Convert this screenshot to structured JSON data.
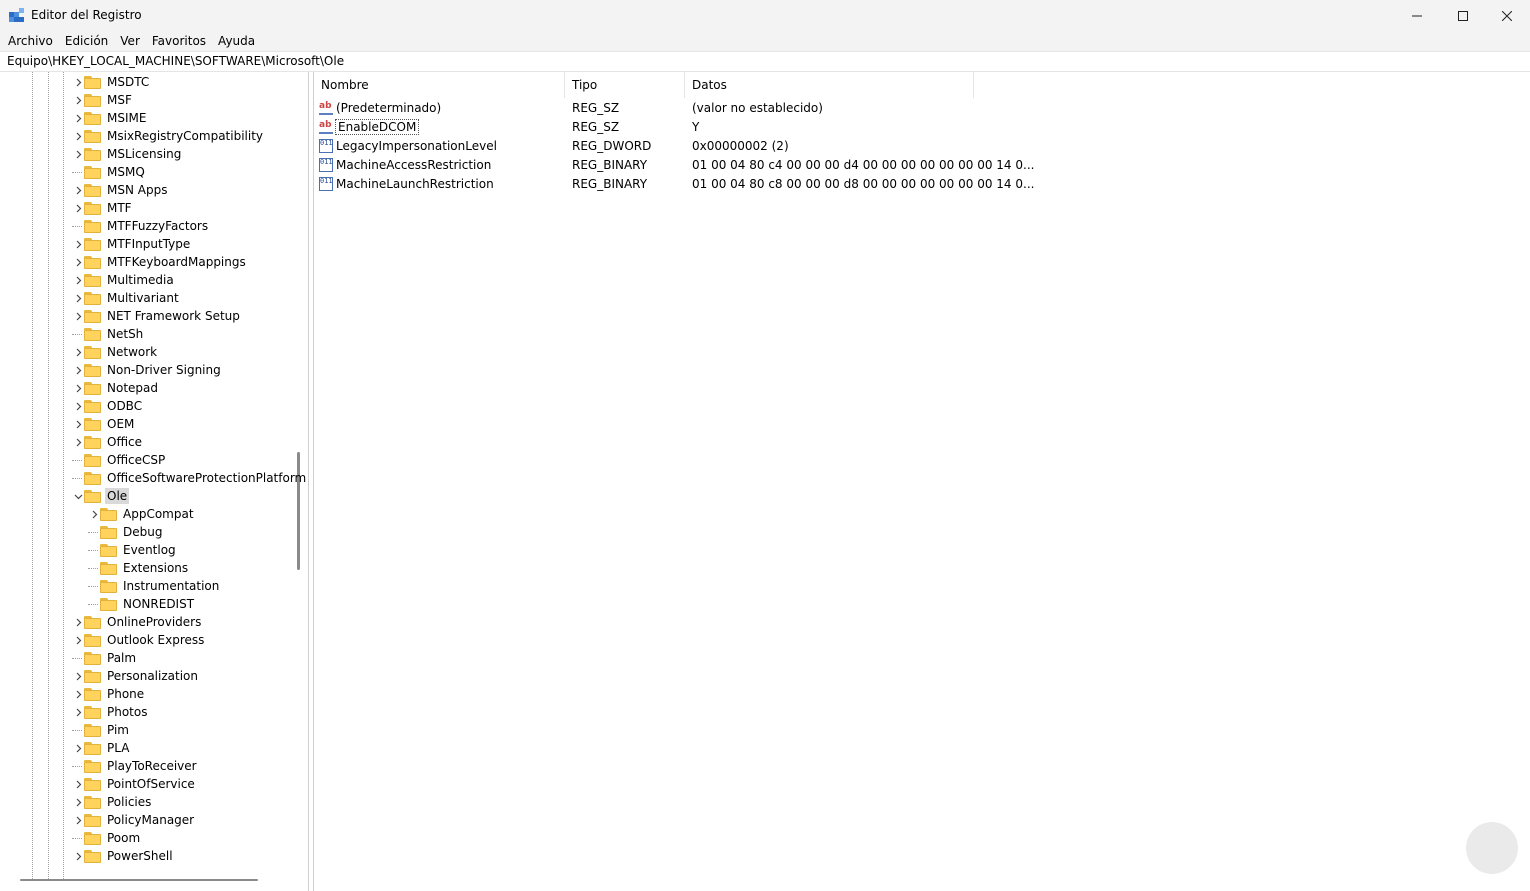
{
  "window": {
    "title": "Editor del Registro",
    "icon": "registry-editor-icon"
  },
  "menu": [
    "Archivo",
    "Edición",
    "Ver",
    "Favoritos",
    "Ayuda"
  ],
  "address": "Equipo\\HKEY_LOCAL_MACHINE\\SOFTWARE\\Microsoft\\Ole",
  "tree": [
    {
      "label": "MSDTC",
      "expandable": true
    },
    {
      "label": "MSF",
      "expandable": true
    },
    {
      "label": "MSIME",
      "expandable": true
    },
    {
      "label": "MsixRegistryCompatibility",
      "expandable": true
    },
    {
      "label": "MSLicensing",
      "expandable": true
    },
    {
      "label": "MSMQ",
      "expandable": false
    },
    {
      "label": "MSN Apps",
      "expandable": true
    },
    {
      "label": "MTF",
      "expandable": true
    },
    {
      "label": "MTFFuzzyFactors",
      "expandable": false
    },
    {
      "label": "MTFInputType",
      "expandable": true
    },
    {
      "label": "MTFKeyboardMappings",
      "expandable": true
    },
    {
      "label": "Multimedia",
      "expandable": true
    },
    {
      "label": "Multivariant",
      "expandable": true
    },
    {
      "label": "NET Framework Setup",
      "expandable": true
    },
    {
      "label": "NetSh",
      "expandable": false
    },
    {
      "label": "Network",
      "expandable": true
    },
    {
      "label": "Non-Driver Signing",
      "expandable": true
    },
    {
      "label": "Notepad",
      "expandable": true
    },
    {
      "label": "ODBC",
      "expandable": true
    },
    {
      "label": "OEM",
      "expandable": true
    },
    {
      "label": "Office",
      "expandable": true
    },
    {
      "label": "OfficeCSP",
      "expandable": false
    },
    {
      "label": "OfficeSoftwareProtectionPlatform",
      "expandable": false
    },
    {
      "label": "Ole",
      "expandable": true,
      "expanded": true,
      "selected": true
    },
    {
      "label": "AppCompat",
      "expandable": true,
      "child": true
    },
    {
      "label": "Debug",
      "expandable": false,
      "child": true
    },
    {
      "label": "Eventlog",
      "expandable": false,
      "child": true
    },
    {
      "label": "Extensions",
      "expandable": false,
      "child": true
    },
    {
      "label": "Instrumentation",
      "expandable": false,
      "child": true
    },
    {
      "label": "NONREDIST",
      "expandable": false,
      "child": true
    },
    {
      "label": "OnlineProviders",
      "expandable": true
    },
    {
      "label": "Outlook Express",
      "expandable": true
    },
    {
      "label": "Palm",
      "expandable": false
    },
    {
      "label": "Personalization",
      "expandable": true
    },
    {
      "label": "Phone",
      "expandable": true
    },
    {
      "label": "Photos",
      "expandable": true
    },
    {
      "label": "Pim",
      "expandable": false
    },
    {
      "label": "PLA",
      "expandable": true
    },
    {
      "label": "PlayToReceiver",
      "expandable": false
    },
    {
      "label": "PointOfService",
      "expandable": true
    },
    {
      "label": "Policies",
      "expandable": true
    },
    {
      "label": "PolicyManager",
      "expandable": true
    },
    {
      "label": "Poom",
      "expandable": false
    },
    {
      "label": "PowerShell",
      "expandable": true
    }
  ],
  "columns": {
    "name": "Nombre",
    "type": "Tipo",
    "data": "Datos"
  },
  "values": [
    {
      "name": "(Predeterminado)",
      "type": "REG_SZ",
      "data": "(valor no establecido)",
      "icon": "string-value-icon"
    },
    {
      "name": "EnableDCOM",
      "type": "REG_SZ",
      "data": "Y",
      "icon": "string-value-icon",
      "focused": true
    },
    {
      "name": "LegacyImpersonationLevel",
      "type": "REG_DWORD",
      "data": "0x00000002 (2)",
      "icon": "binary-value-icon"
    },
    {
      "name": "MachineAccessRestriction",
      "type": "REG_BINARY",
      "data": "01 00 04 80 c4 00 00 00 d4 00 00 00 00 00 00 00 14 0...",
      "icon": "binary-value-icon"
    },
    {
      "name": "MachineLaunchRestriction",
      "type": "REG_BINARY",
      "data": "01 00 04 80 c8 00 00 00 d8 00 00 00 00 00 00 00 14 0...",
      "icon": "binary-value-icon"
    }
  ],
  "icon_glyphs": {
    "string": "ab",
    "binary": "011 110"
  }
}
